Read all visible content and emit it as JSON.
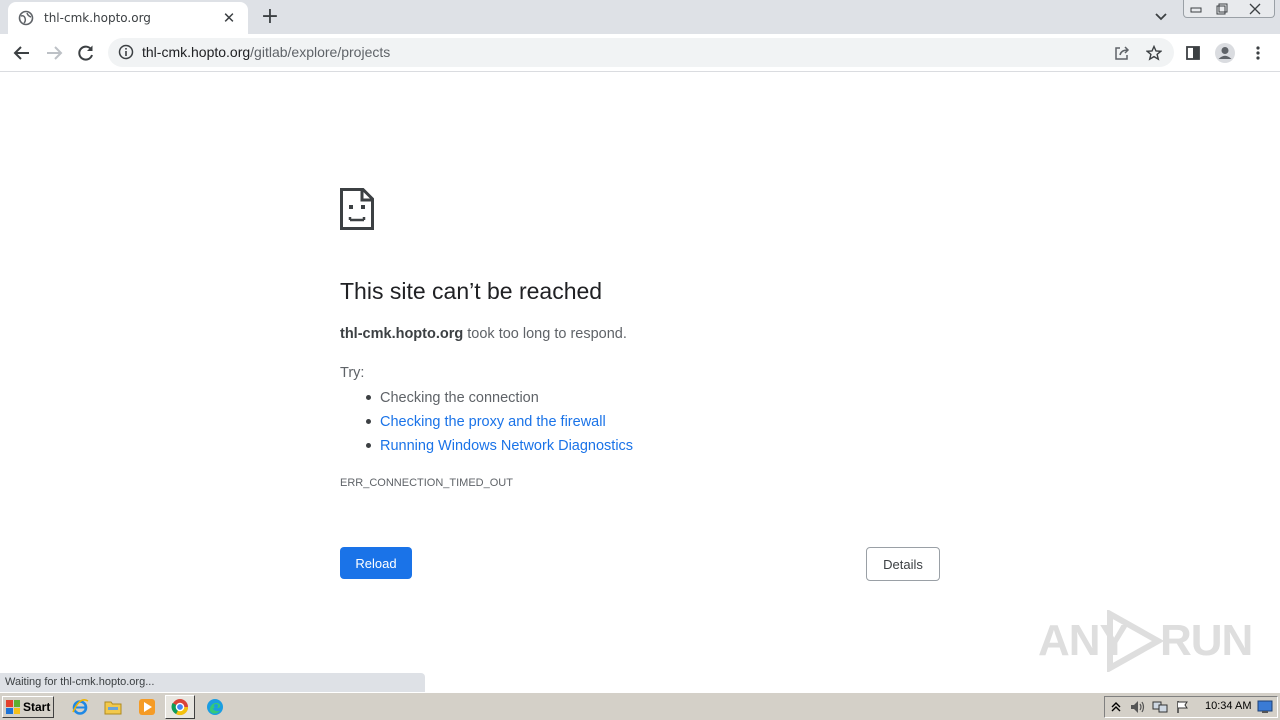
{
  "browser": {
    "tab": {
      "title": "thl-cmk.hopto.org",
      "favicon": "globe-icon"
    },
    "new_tab_symbol": "+",
    "address": {
      "host": "thl-cmk.hopto.org",
      "path": "/gitlab/explore/projects"
    }
  },
  "error_page": {
    "icon": "sad-document-icon",
    "title": "This site can’t be reached",
    "host": "thl-cmk.hopto.org",
    "message": " took too long to respond.",
    "try_label": "Try:",
    "suggestions": [
      {
        "text": "Checking the connection",
        "is_link": false
      },
      {
        "text": "Checking the proxy and the firewall",
        "is_link": true
      },
      {
        "text": "Running Windows Network Diagnostics",
        "is_link": true
      }
    ],
    "error_code": "ERR_CONNECTION_TIMED_OUT",
    "reload_label": "Reload",
    "details_label": "Details",
    "accent_color": "#1a73e8"
  },
  "status_bar": {
    "text": "Waiting for thl-cmk.hopto.org..."
  },
  "watermark": {
    "left": "ANY",
    "right": "RUN"
  },
  "taskbar": {
    "start_label": "Start",
    "quick_launch": [
      "ie-icon",
      "explorer-icon",
      "media-player-icon",
      "chrome-icon",
      "edge-icon"
    ],
    "clock": "10:34 AM"
  }
}
